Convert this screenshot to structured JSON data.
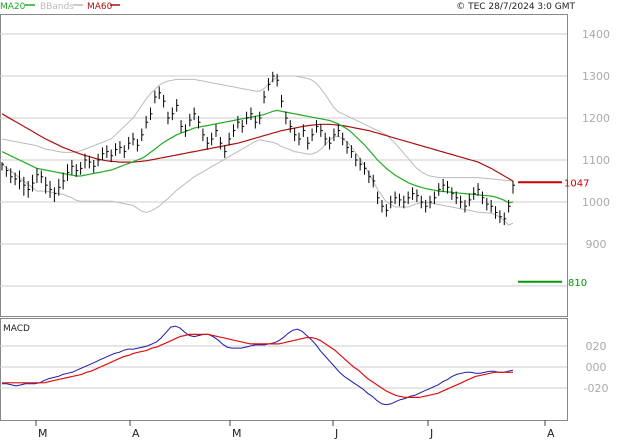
{
  "legend": {
    "ma20": "MA20",
    "bbands": "BBands",
    "ma60": "MA60"
  },
  "copyright": "© TEC 28/7/2024 3:0 GMT",
  "macd_label": "MACD",
  "colors": {
    "ma20": "#22aa22",
    "bbands": "#bbbbbb",
    "ma60": "#aa1111",
    "bars": "#000000",
    "macd": "#1a1aaa",
    "signal": "#dd1111",
    "resistance": "#cc0000",
    "support": "#009900",
    "grid": "#cccccc",
    "axis_text": "#aaaaaa"
  },
  "chart_data": [
    {
      "type": "ohlc",
      "y_ticks": [
        "1400",
        "1300",
        "1200",
        "1100",
        "1000",
        "900"
      ],
      "y_tick_values": [
        1400,
        1300,
        1200,
        1100,
        1000,
        900
      ],
      "ylim": [
        800,
        1500
      ],
      "x_ticks": [
        "M",
        "A",
        "M",
        "J",
        "J",
        "A"
      ],
      "series_names": [
        "MA20",
        "BBands",
        "MA60"
      ],
      "levels": [
        {
          "label": "1047",
          "value": 1047,
          "role": "resistance"
        },
        {
          "label": "810",
          "value": 810,
          "role": "support"
        }
      ],
      "price": [
        1090,
        1075,
        1060,
        1055,
        1050,
        1040,
        1030,
        1045,
        1065,
        1060,
        1040,
        1030,
        1020,
        1035,
        1050,
        1070,
        1085,
        1075,
        1080,
        1100,
        1095,
        1085,
        1100,
        1115,
        1120,
        1110,
        1125,
        1130,
        1120,
        1140,
        1150,
        1135,
        1160,
        1190,
        1210,
        1250,
        1260,
        1240,
        1200,
        1210,
        1230,
        1180,
        1170,
        1195,
        1210,
        1190,
        1160,
        1140,
        1150,
        1170,
        1140,
        1120,
        1150,
        1170,
        1190,
        1180,
        1200,
        1210,
        1190,
        1200,
        1250,
        1280,
        1300,
        1290,
        1240,
        1200,
        1180,
        1160,
        1150,
        1170,
        1140,
        1160,
        1180,
        1170,
        1150,
        1140,
        1160,
        1170,
        1150,
        1130,
        1120,
        1100,
        1090,
        1080,
        1060,
        1050,
        1010,
        990,
        980,
        1000,
        1010,
        1005,
        1000,
        1010,
        1020,
        1015,
        1000,
        990,
        1000,
        1010,
        1030,
        1040,
        1035,
        1020,
        1010,
        1000,
        990,
        1005,
        1020,
        1030,
        1010,
        995,
        990,
        975,
        965,
        960,
        990,
        1040
      ],
      "ma20": [
        1120,
        1115,
        1110,
        1105,
        1100,
        1095,
        1090,
        1085,
        1080,
        1078,
        1076,
        1074,
        1072,
        1070,
        1068,
        1066,
        1064,
        1062,
        1062,
        1064,
        1066,
        1068,
        1070,
        1072,
        1074,
        1076,
        1080,
        1084,
        1088,
        1092,
        1096,
        1100,
        1104,
        1110,
        1118,
        1126,
        1134,
        1142,
        1148,
        1154,
        1160,
        1164,
        1168,
        1172,
        1176,
        1178,
        1180,
        1182,
        1184,
        1186,
        1188,
        1190,
        1192,
        1194,
        1196,
        1198,
        1200,
        1202,
        1204,
        1206,
        1208,
        1212,
        1216,
        1218,
        1216,
        1214,
        1212,
        1210,
        1208,
        1206,
        1204,
        1202,
        1200,
        1198,
        1196,
        1194,
        1190,
        1186,
        1180,
        1174,
        1166,
        1156,
        1146,
        1136,
        1124,
        1112,
        1100,
        1090,
        1080,
        1072,
        1064,
        1058,
        1052,
        1046,
        1042,
        1038,
        1035,
        1032,
        1030,
        1028,
        1026,
        1025,
        1024,
        1023,
        1022,
        1021,
        1020,
        1019,
        1018,
        1017,
        1016,
        1015,
        1014,
        1012,
        1008,
        1004,
        998,
        1000
      ],
      "ma60": [
        1210,
        1204,
        1198,
        1192,
        1186,
        1180,
        1174,
        1168,
        1162,
        1156,
        1150,
        1145,
        1140,
        1135,
        1130,
        1126,
        1122,
        1118,
        1114,
        1111,
        1108,
        1105,
        1102,
        1100,
        1098,
        1097,
        1096,
        1095,
        1095,
        1095,
        1095,
        1096,
        1097,
        1098,
        1100,
        1102,
        1104,
        1106,
        1108,
        1110,
        1112,
        1114,
        1116,
        1118,
        1120,
        1122,
        1124,
        1126,
        1128,
        1130,
        1132,
        1134,
        1136,
        1138,
        1140,
        1143,
        1146,
        1149,
        1152,
        1155,
        1158,
        1161,
        1164,
        1167,
        1170,
        1172,
        1174,
        1176,
        1178,
        1180,
        1182,
        1183,
        1184,
        1185,
        1185,
        1185,
        1184,
        1183,
        1182,
        1180,
        1178,
        1176,
        1174,
        1172,
        1170,
        1167,
        1164,
        1161,
        1158,
        1155,
        1152,
        1149,
        1146,
        1143,
        1140,
        1137,
        1134,
        1131,
        1128,
        1125,
        1122,
        1119,
        1116,
        1113,
        1110,
        1107,
        1104,
        1101,
        1098,
        1095,
        1090,
        1085,
        1080,
        1074,
        1068,
        1062,
        1056,
        1050
      ],
      "bb_upper": [
        1150,
        1148,
        1146,
        1144,
        1142,
        1140,
        1138,
        1136,
        1134,
        1130,
        1126,
        1124,
        1122,
        1120,
        1118,
        1118,
        1118,
        1120,
        1122,
        1126,
        1130,
        1134,
        1138,
        1142,
        1146,
        1150,
        1160,
        1170,
        1180,
        1190,
        1200,
        1215,
        1230,
        1245,
        1258,
        1268,
        1278,
        1284,
        1288,
        1290,
        1292,
        1292,
        1292,
        1292,
        1292,
        1290,
        1288,
        1286,
        1284,
        1282,
        1280,
        1278,
        1276,
        1274,
        1272,
        1270,
        1268,
        1266,
        1264,
        1264,
        1270,
        1280,
        1290,
        1298,
        1300,
        1300,
        1300,
        1300,
        1298,
        1296,
        1294,
        1290,
        1282,
        1270,
        1256,
        1240,
        1225,
        1215,
        1210,
        1205,
        1200,
        1195,
        1190,
        1185,
        1180,
        1175,
        1170,
        1165,
        1160,
        1150,
        1140,
        1128,
        1116,
        1104,
        1092,
        1080,
        1072,
        1066,
        1062,
        1060,
        1058,
        1058,
        1058,
        1058,
        1058,
        1058,
        1058,
        1058,
        1058,
        1058,
        1057,
        1056,
        1055,
        1054,
        1053,
        1052,
        1051,
        1050
      ],
      "bb_lower": [
        1090,
        1082,
        1074,
        1066,
        1058,
        1050,
        1042,
        1034,
        1026,
        1026,
        1026,
        1024,
        1022,
        1020,
        1018,
        1014,
        1010,
        1004,
        1002,
        1002,
        1002,
        1002,
        1002,
        1002,
        1002,
        1002,
        1000,
        998,
        996,
        994,
        992,
        985,
        978,
        975,
        978,
        984,
        990,
        1000,
        1008,
        1018,
        1028,
        1036,
        1044,
        1052,
        1060,
        1066,
        1072,
        1078,
        1084,
        1090,
        1096,
        1102,
        1108,
        1114,
        1120,
        1126,
        1132,
        1138,
        1144,
        1148,
        1146,
        1144,
        1142,
        1138,
        1132,
        1128,
        1124,
        1120,
        1118,
        1116,
        1114,
        1114,
        1118,
        1126,
        1136,
        1148,
        1155,
        1157,
        1150,
        1143,
        1132,
        1117,
        1102,
        1087,
        1068,
        1049,
        1030,
        1015,
        1000,
        994,
        988,
        988,
        988,
        988,
        992,
        996,
        998,
        998,
        998,
        996,
        994,
        992,
        990,
        988,
        986,
        984,
        982,
        980,
        978,
        976,
        975,
        974,
        973,
        970,
        963,
        956,
        945,
        950
      ],
      "ohlc_ranges": [
        [
          1095,
          1075
        ],
        [
          1085,
          1060
        ],
        [
          1080,
          1045
        ],
        [
          1070,
          1040
        ],
        [
          1075,
          1030
        ],
        [
          1060,
          1015
        ],
        [
          1050,
          1010
        ],
        [
          1065,
          1025
        ],
        [
          1080,
          1045
        ],
        [
          1075,
          1045
        ],
        [
          1060,
          1020
        ],
        [
          1050,
          1010
        ],
        [
          1035,
          1000
        ],
        [
          1055,
          1015
        ],
        [
          1070,
          1030
        ],
        [
          1090,
          1050
        ],
        [
          1100,
          1065
        ],
        [
          1090,
          1060
        ],
        [
          1095,
          1065
        ],
        [
          1115,
          1080
        ],
        [
          1110,
          1080
        ],
        [
          1100,
          1070
        ],
        [
          1115,
          1085
        ],
        [
          1130,
          1100
        ],
        [
          1135,
          1105
        ],
        [
          1125,
          1095
        ],
        [
          1140,
          1110
        ],
        [
          1145,
          1115
        ],
        [
          1135,
          1105
        ],
        [
          1155,
          1125
        ],
        [
          1165,
          1135
        ],
        [
          1150,
          1120
        ],
        [
          1175,
          1145
        ],
        [
          1205,
          1175
        ],
        [
          1225,
          1195
        ],
        [
          1265,
          1235
        ],
        [
          1275,
          1245
        ],
        [
          1255,
          1225
        ],
        [
          1215,
          1185
        ],
        [
          1225,
          1195
        ],
        [
          1245,
          1215
        ],
        [
          1195,
          1165
        ],
        [
          1185,
          1155
        ],
        [
          1210,
          1180
        ],
        [
          1225,
          1195
        ],
        [
          1205,
          1175
        ],
        [
          1175,
          1145
        ],
        [
          1155,
          1125
        ],
        [
          1165,
          1135
        ],
        [
          1185,
          1155
        ],
        [
          1155,
          1125
        ],
        [
          1135,
          1105
        ],
        [
          1165,
          1135
        ],
        [
          1185,
          1155
        ],
        [
          1205,
          1175
        ],
        [
          1195,
          1165
        ],
        [
          1215,
          1185
        ],
        [
          1225,
          1195
        ],
        [
          1205,
          1175
        ],
        [
          1215,
          1185
        ],
        [
          1265,
          1235
        ],
        [
          1295,
          1265
        ],
        [
          1310,
          1285
        ],
        [
          1305,
          1275
        ],
        [
          1255,
          1225
        ],
        [
          1215,
          1185
        ],
        [
          1195,
          1165
        ],
        [
          1175,
          1145
        ],
        [
          1165,
          1135
        ],
        [
          1185,
          1155
        ],
        [
          1155,
          1125
        ],
        [
          1175,
          1145
        ],
        [
          1195,
          1165
        ],
        [
          1185,
          1155
        ],
        [
          1165,
          1135
        ],
        [
          1155,
          1125
        ],
        [
          1175,
          1145
        ],
        [
          1185,
          1155
        ],
        [
          1165,
          1135
        ],
        [
          1145,
          1115
        ],
        [
          1135,
          1105
        ],
        [
          1115,
          1085
        ],
        [
          1105,
          1075
        ],
        [
          1095,
          1065
        ],
        [
          1075,
          1045
        ],
        [
          1065,
          1035
        ],
        [
          1025,
          995
        ],
        [
          1005,
          975
        ],
        [
          995,
          965
        ],
        [
          1015,
          985
        ],
        [
          1025,
          995
        ],
        [
          1020,
          990
        ],
        [
          1015,
          985
        ],
        [
          1025,
          995
        ],
        [
          1035,
          1005
        ],
        [
          1030,
          1000
        ],
        [
          1015,
          985
        ],
        [
          1005,
          975
        ],
        [
          1015,
          985
        ],
        [
          1025,
          995
        ],
        [
          1045,
          1015
        ],
        [
          1055,
          1025
        ],
        [
          1050,
          1020
        ],
        [
          1035,
          1005
        ],
        [
          1025,
          995
        ],
        [
          1015,
          985
        ],
        [
          1005,
          975
        ],
        [
          1020,
          990
        ],
        [
          1035,
          1005
        ],
        [
          1045,
          1015
        ],
        [
          1025,
          995
        ],
        [
          1010,
          980
        ],
        [
          1005,
          975
        ],
        [
          990,
          960
        ],
        [
          980,
          950
        ],
        [
          975,
          945
        ],
        [
          1005,
          975
        ],
        [
          1050,
          1020
        ]
      ]
    },
    {
      "type": "line",
      "title": "MACD",
      "y_ticks": [
        "020",
        "000",
        "-020"
      ],
      "y_tick_values": [
        20,
        0,
        -20
      ],
      "ylim": [
        -55,
        45
      ],
      "series_names": [
        "MACD",
        "Signal"
      ],
      "macd": [
        -16,
        -16,
        -17,
        -18,
        -17,
        -16,
        -16,
        -16,
        -15,
        -13,
        -11,
        -10,
        -9,
        -7,
        -6,
        -5,
        -3,
        -1,
        1,
        3,
        5,
        7,
        9,
        11,
        13,
        14,
        16,
        17,
        17,
        18,
        19,
        20,
        22,
        24,
        28,
        33,
        38,
        39,
        37,
        33,
        30,
        29,
        30,
        31,
        31,
        29,
        26,
        22,
        19,
        18,
        18,
        18,
        19,
        20,
        21,
        21,
        21,
        22,
        23,
        25,
        28,
        32,
        35,
        36,
        34,
        30,
        26,
        21,
        15,
        10,
        5,
        0,
        -5,
        -9,
        -12,
        -15,
        -18,
        -21,
        -25,
        -28,
        -32,
        -35,
        -36,
        -35,
        -33,
        -31,
        -30,
        -28,
        -27,
        -25,
        -23,
        -21,
        -19,
        -17,
        -14,
        -12,
        -9,
        -7,
        -6,
        -5,
        -5,
        -6,
        -6,
        -5,
        -4,
        -4,
        -5,
        -5,
        -4,
        -3
      ]
    },
    {
      "type": "line",
      "series_names": [
        "Signal"
      ],
      "signal": [
        -15,
        -15,
        -15,
        -15,
        -15,
        -15,
        -15,
        -15,
        -15,
        -15,
        -14,
        -13,
        -12,
        -11,
        -10,
        -9,
        -8,
        -7,
        -5,
        -4,
        -2,
        0,
        2,
        4,
        6,
        8,
        10,
        11,
        13,
        14,
        15,
        16,
        18,
        19,
        21,
        23,
        25,
        27,
        29,
        30,
        31,
        31,
        31,
        31,
        31,
        30,
        29,
        28,
        27,
        26,
        25,
        24,
        23,
        22,
        22,
        22,
        22,
        22,
        22,
        22,
        23,
        24,
        25,
        26,
        27,
        28,
        28,
        27,
        25,
        22,
        19,
        16,
        12,
        8,
        4,
        0,
        -3,
        -7,
        -11,
        -14,
        -17,
        -20,
        -23,
        -25,
        -27,
        -28,
        -29,
        -29,
        -29,
        -29,
        -28,
        -27,
        -26,
        -25,
        -23,
        -21,
        -19,
        -17,
        -15,
        -13,
        -11,
        -9,
        -8,
        -7,
        -6,
        -5,
        -5,
        -5,
        -5,
        -5
      ]
    }
  ]
}
